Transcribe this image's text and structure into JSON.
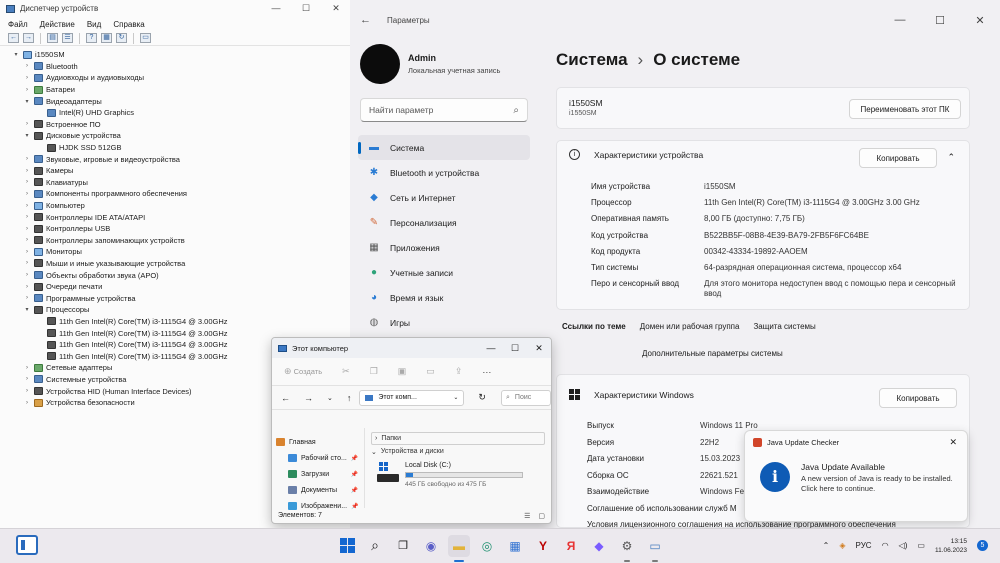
{
  "device_manager": {
    "title": "Диспетчер устройств",
    "menu": [
      "Файл",
      "Действие",
      "Вид",
      "Справка"
    ],
    "tree": [
      {
        "level": 0,
        "arrow": "▾",
        "icon": "pc",
        "label": "i1550SM"
      },
      {
        "level": 1,
        "arrow": "›",
        "icon": "blue",
        "label": "Bluetooth"
      },
      {
        "level": 1,
        "arrow": "›",
        "icon": "blue",
        "label": "Аудиовходы и аудиовыходы"
      },
      {
        "level": 1,
        "arrow": "›",
        "icon": "green",
        "label": "Батареи"
      },
      {
        "level": 1,
        "arrow": "▾",
        "icon": "blue",
        "label": "Видеоадаптеры"
      },
      {
        "level": 2,
        "arrow": "",
        "icon": "blue",
        "label": "Intel(R) UHD Graphics"
      },
      {
        "level": 1,
        "arrow": "›",
        "icon": "dark",
        "label": "Встроенное ПО"
      },
      {
        "level": 1,
        "arrow": "▾",
        "icon": "dark",
        "label": "Дисковые устройства"
      },
      {
        "level": 2,
        "arrow": "",
        "icon": "dark",
        "label": "HJDK SSD 512GB"
      },
      {
        "level": 1,
        "arrow": "›",
        "icon": "blue",
        "label": "Звуковые, игровые и видеоустройства"
      },
      {
        "level": 1,
        "arrow": "›",
        "icon": "dark",
        "label": "Камеры"
      },
      {
        "level": 1,
        "arrow": "›",
        "icon": "dark",
        "label": "Клавиатуры"
      },
      {
        "level": 1,
        "arrow": "›",
        "icon": "blue",
        "label": "Компоненты программного обеспечения"
      },
      {
        "level": 1,
        "arrow": "›",
        "icon": "pc",
        "label": "Компьютер"
      },
      {
        "level": 1,
        "arrow": "›",
        "icon": "dark",
        "label": "Контроллеры IDE ATA/ATAPI"
      },
      {
        "level": 1,
        "arrow": "›",
        "icon": "dark",
        "label": "Контроллеры USB"
      },
      {
        "level": 1,
        "arrow": "›",
        "icon": "dark",
        "label": "Контроллеры запоминающих устройств"
      },
      {
        "level": 1,
        "arrow": "›",
        "icon": "pc",
        "label": "Мониторы"
      },
      {
        "level": 1,
        "arrow": "›",
        "icon": "dark",
        "label": "Мыши и иные указывающие устройства"
      },
      {
        "level": 1,
        "arrow": "›",
        "icon": "blue",
        "label": "Объекты обработки звука (APO)"
      },
      {
        "level": 1,
        "arrow": "›",
        "icon": "dark",
        "label": "Очереди печати"
      },
      {
        "level": 1,
        "arrow": "›",
        "icon": "blue",
        "label": "Программные устройства"
      },
      {
        "level": 1,
        "arrow": "▾",
        "icon": "dark",
        "label": "Процессоры"
      },
      {
        "level": 2,
        "arrow": "",
        "icon": "dark",
        "label": "11th Gen Intel(R) Core(TM) i3-1115G4 @ 3.00GHz"
      },
      {
        "level": 2,
        "arrow": "",
        "icon": "dark",
        "label": "11th Gen Intel(R) Core(TM) i3-1115G4 @ 3.00GHz"
      },
      {
        "level": 2,
        "arrow": "",
        "icon": "dark",
        "label": "11th Gen Intel(R) Core(TM) i3-1115G4 @ 3.00GHz"
      },
      {
        "level": 2,
        "arrow": "",
        "icon": "dark",
        "label": "11th Gen Intel(R) Core(TM) i3-1115G4 @ 3.00GHz"
      },
      {
        "level": 1,
        "arrow": "›",
        "icon": "green",
        "label": "Сетевые адаптеры"
      },
      {
        "level": 1,
        "arrow": "›",
        "icon": "blue",
        "label": "Системные устройства"
      },
      {
        "level": 1,
        "arrow": "›",
        "icon": "dark",
        "label": "Устройства HID (Human Interface Devices)"
      },
      {
        "level": 1,
        "arrow": "›",
        "icon": "orange",
        "label": "Устройства безопасности"
      }
    ]
  },
  "settings": {
    "title": "Параметры",
    "user_name": "Admin",
    "user_role": "Локальная учетная запись",
    "search_placeholder": "Найти параметр",
    "nav": [
      {
        "label": "Система",
        "icon": "▬",
        "color": "#2b7cd3",
        "active": true
      },
      {
        "label": "Bluetooth и устройства",
        "icon": "✱",
        "color": "#2b7cd3",
        "active": false
      },
      {
        "label": "Сеть и Интернет",
        "icon": "◆",
        "color": "#2b7cd3",
        "active": false
      },
      {
        "label": "Персонализация",
        "icon": "✎",
        "color": "#d2693a",
        "active": false
      },
      {
        "label": "Приложения",
        "icon": "▦",
        "color": "#555555",
        "active": false
      },
      {
        "label": "Учетные записи",
        "icon": "●",
        "color": "#2ea37a",
        "active": false
      },
      {
        "label": "Время и язык",
        "icon": "◕",
        "color": "#2b7cd3",
        "active": false
      },
      {
        "label": "Игры",
        "icon": "◍",
        "color": "#666666",
        "active": false
      }
    ],
    "breadcrumb_parent": "Система",
    "breadcrumb_chevron": "›",
    "breadcrumb_current": "О системе",
    "device_name": "i1550SM",
    "device_name_sub": "i1550SM",
    "rename_button": "Переименовать этот ПК",
    "specs_header": "Характеристики устройства",
    "copy_button": "Копировать",
    "specs": [
      {
        "k": "Имя устройства",
        "v": "i1550SM"
      },
      {
        "k": "Процессор",
        "v": "11th Gen Intel(R) Core(TM) i3-1115G4 @ 3.00GHz   3.00 GHz"
      },
      {
        "k": "Оперативная память",
        "v": "8,00 ГБ (доступно: 7,75 ГБ)"
      },
      {
        "k": "Код устройства",
        "v": "B522BB5F-08B8-4E39-BA79-2FB5F6FC64BE"
      },
      {
        "k": "Код продукта",
        "v": "00342-43334-19892-AAOEM"
      },
      {
        "k": "Тип системы",
        "v": "64-разрядная операционная система, процессор x64"
      },
      {
        "k": "Перо и сенсорный ввод",
        "v": "Для этого монитора недоступен ввод с помощью пера и сенсорный ввод"
      }
    ],
    "related_links_title": "Ссылки по теме",
    "related_links": [
      "Домен или рабочая группа",
      "Защита системы"
    ],
    "advanced_link": "Дополнительные параметры системы",
    "windows_header": "Характеристики Windows",
    "windows_copy_button": "Копировать",
    "windows_specs": [
      {
        "k": "Выпуск",
        "v": "Windows 11 Pro"
      },
      {
        "k": "Версия",
        "v": "22H2"
      },
      {
        "k": "Дата установки",
        "v": "15.03.2023"
      },
      {
        "k": "Сборка ОС",
        "v": "22621.521"
      },
      {
        "k": "Взаимодействие",
        "v": "Windows Fe"
      },
      {
        "k": "Соглашение об использовании служб М",
        "v": ""
      },
      {
        "k": "Условия лицензионного соглашения на использование программного обеспечения",
        "v": ""
      }
    ]
  },
  "explorer": {
    "title": "Этот компьютер",
    "create_label": "Создать",
    "address": "Этот комп...",
    "search_placeholder": "Поис",
    "sidebar": [
      {
        "label": "Главная",
        "pinned": false
      },
      {
        "label": "Рабочий сто...",
        "pinned": true
      },
      {
        "label": "Загрузки",
        "pinned": true
      },
      {
        "label": "Документы",
        "pinned": true
      },
      {
        "label": "Изображени...",
        "pinned": true
      }
    ],
    "group_folders": "Папки",
    "group_devices": "Устройства и диски",
    "disk_name": "Local Disk (C:)",
    "disk_used_fraction": 0.06,
    "disk_free": "445 ГБ свободно из 475 ГБ",
    "status": "Элементов: 7"
  },
  "toast": {
    "app": "Java Update Checker",
    "title": "Java Update Available",
    "message_1": "A new version of Java is ready to be installed.",
    "message_2": "Click here to continue."
  },
  "taskbar": {
    "lang": "РУС",
    "time": "13:15",
    "date": "11.06.2023",
    "badge": "5"
  }
}
